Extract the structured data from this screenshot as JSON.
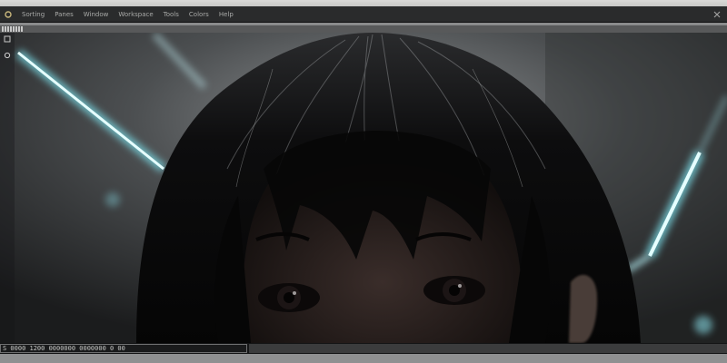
{
  "menubar": {
    "items": [
      "Sorting",
      "Panes",
      "Window",
      "Workspace",
      "Tools",
      "Colors",
      "Help"
    ]
  },
  "icons": {
    "app": "app-logo-icon",
    "close": "close-icon",
    "rail_top": "layers-icon",
    "rail_second": "circle-icon"
  },
  "viewport": {
    "subject": "portrait render"
  },
  "timeline": {
    "label": "S 0000 1200 0000000 0000000 0 00"
  },
  "colors": {
    "accent_glow": "#7fe6f2",
    "chrome_dark": "#2a2b2c",
    "chrome_light": "#c8c8c6"
  }
}
